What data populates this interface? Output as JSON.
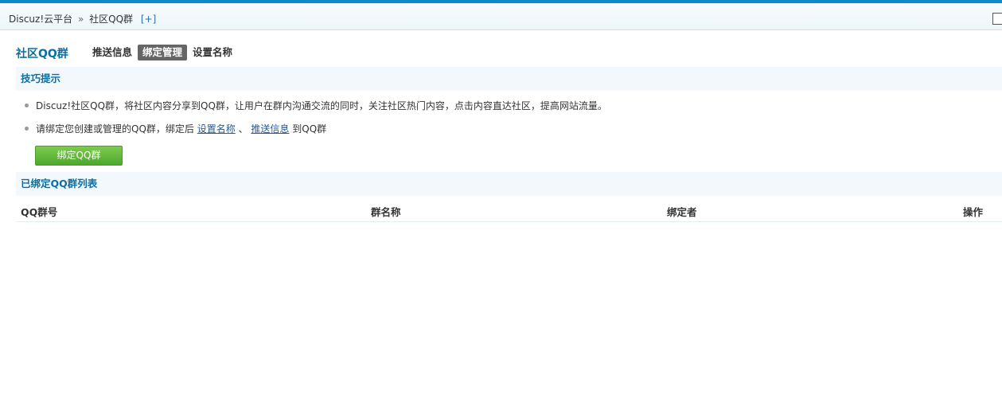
{
  "breadcrumb": {
    "root": "Discuz!云平台",
    "separator": "»",
    "current": "社区QQ群",
    "add": "[+]"
  },
  "page": {
    "title": "社区QQ群"
  },
  "tabs": [
    {
      "label": "推送信息",
      "active": false
    },
    {
      "label": "绑定管理",
      "active": true
    },
    {
      "label": "设置名称",
      "active": false
    }
  ],
  "tips": {
    "heading": "技巧提示",
    "item1": "Discuz!社区QQ群，将社区内容分享到QQ群，让用户在群内沟通交流的同时，关注社区热门内容，点击内容直达社区，提高网站流量。",
    "item2_prefix": "请绑定您创建或管理的QQ群，绑定后",
    "item2_link1": "设置名称",
    "item2_sep": "、",
    "item2_link2": "推送信息",
    "item2_suffix": "到QQ群"
  },
  "bind_button": "绑定QQ群",
  "bound_list": {
    "heading": "已绑定QQ群列表",
    "columns": [
      "QQ群号",
      "群名称",
      "绑定者",
      "操作"
    ]
  }
}
